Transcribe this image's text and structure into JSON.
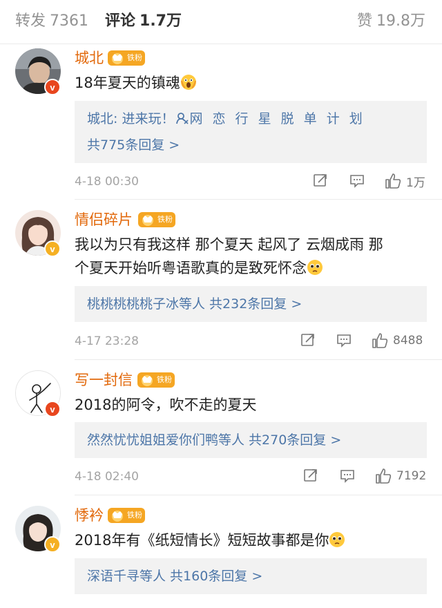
{
  "tabs": {
    "repost_label": "转发",
    "repost_count": "7361",
    "comment_label": "评论",
    "comment_count": "1.7万",
    "like_label": "赞",
    "like_count": "19.8万"
  },
  "badge_text": "铁粉",
  "comments": [
    {
      "user": "城北",
      "text": "18年夏天的镇魂",
      "emoji": "shocked-face-emoji",
      "reply_author": "城北:",
      "reply_prefix": " 进来玩！",
      "reply_link": "网 恋 行 星 脱 单 计 划",
      "reply_count": "共775条回复 >",
      "time": "4-18 00:30",
      "likes": "1万",
      "verified": "red"
    },
    {
      "user": "情侣碎片",
      "text_line1": "我以为只有我这样 那个夏天 起风了 云烟成雨 那",
      "text_line2": "个夏天开始听粤语歌真的是致死怀念",
      "emoji": "pleading-face-emoji",
      "reply_summary": "桃桃桃桃桃子冰等人 共232条回复 >",
      "time": "4-17 23:28",
      "likes": "8488",
      "verified": "gold"
    },
    {
      "user": "写一封信",
      "text": "2018的阿令，吹不走的夏天",
      "reply_summary": "然然忧忧姐姐爱你们鸭等人 共270条回复 >",
      "time": "4-18 02:40",
      "likes": "7192",
      "verified": "red"
    },
    {
      "user": "悸衿",
      "text": "2018年有《纸短情长》短短故事都是你",
      "emoji": "pleading-face-emoji",
      "reply_summary": "深语千寻等人 共160条回复 >",
      "verified": "gold"
    }
  ],
  "colors": {
    "username": "#e2690c",
    "link": "#4d76a8",
    "fan_badge": "#f5a623",
    "verified_red": "#e8461e",
    "verified_gold": "#f5b023"
  }
}
